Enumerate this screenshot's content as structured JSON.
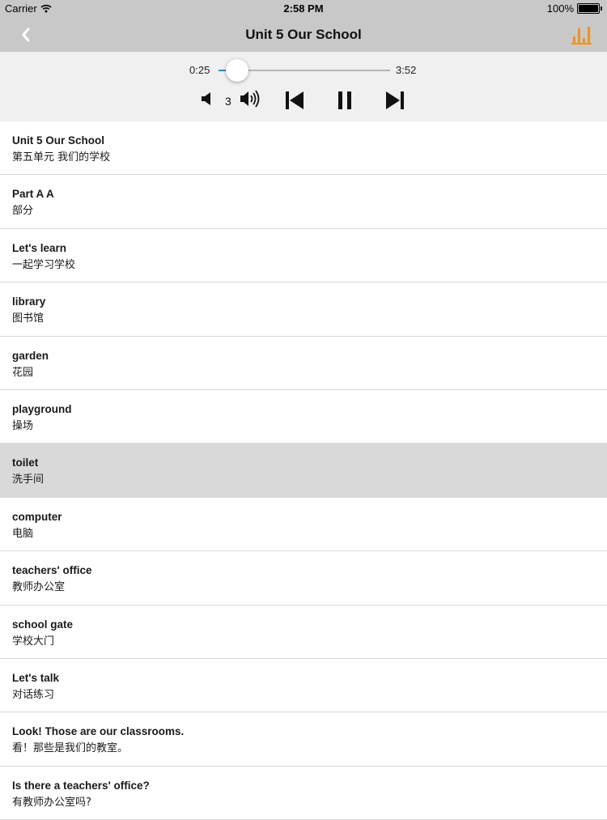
{
  "status": {
    "carrier": "Carrier",
    "time": "2:58 PM",
    "battery": "100%"
  },
  "nav": {
    "title": "Unit 5 Our School",
    "accent": "#f0931e"
  },
  "player": {
    "current_time": "0:25",
    "total_time": "3:52",
    "progress": 0.11,
    "volume": "3",
    "progress_color": "#1f8fe0",
    "icons": [
      "volume-low-icon",
      "volume-high-icon",
      "previous-track-icon",
      "pause-icon",
      "next-track-icon"
    ]
  },
  "items": [
    {
      "en": "Unit 5 Our School",
      "zh": "第五单元 我们的学校"
    },
    {
      "en": "Part A  A",
      "zh": "部分"
    },
    {
      "en": "Let's learn",
      "zh": "一起学习学校"
    },
    {
      "en": "library",
      "zh": "图书馆"
    },
    {
      "en": "garden",
      "zh": "花园"
    },
    {
      "en": "playground",
      "zh": "操场"
    },
    {
      "en": "toilet",
      "zh": "洗手间",
      "selected": true
    },
    {
      "en": "computer",
      "zh": "电脑"
    },
    {
      "en": "teachers' office",
      "zh": "教师办公室"
    },
    {
      "en": "school gate",
      "zh": "学校大门"
    },
    {
      "en": "Let's talk",
      "zh": "对话练习"
    },
    {
      "en": "Look! Those are our classrooms.",
      "zh": "看！那些是我们的教室。"
    },
    {
      "en": "Is there a teachers' office?",
      "zh": "有教师办公室吗?"
    }
  ]
}
